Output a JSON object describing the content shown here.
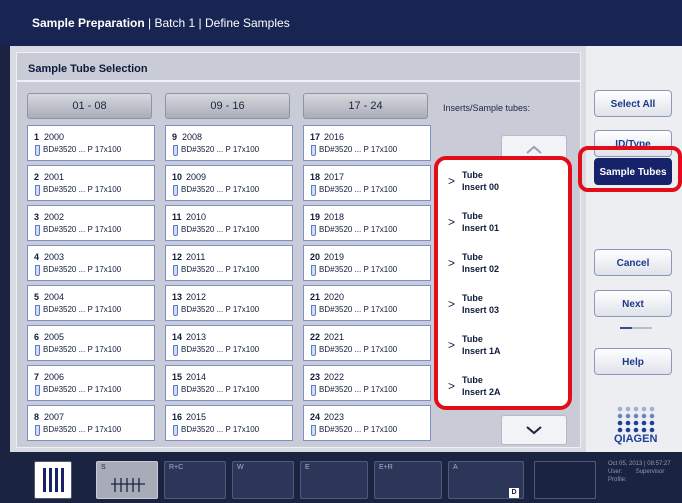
{
  "header": {
    "title_bold": "Sample Preparation",
    "title_rest": " | Batch 1 | Define Samples"
  },
  "panel": {
    "title": "Sample Tube Selection",
    "inserts_label": "Inserts/Sample tubes:"
  },
  "column_headers": [
    "01 - 08",
    "09 - 16",
    "17 - 24"
  ],
  "tube_type": "BD#3520 ... P 17x100",
  "tubes": [
    {
      "num": "1",
      "id": "2000"
    },
    {
      "num": "2",
      "id": "2001"
    },
    {
      "num": "3",
      "id": "2002"
    },
    {
      "num": "4",
      "id": "2003"
    },
    {
      "num": "5",
      "id": "2004"
    },
    {
      "num": "6",
      "id": "2005"
    },
    {
      "num": "7",
      "id": "2006"
    },
    {
      "num": "8",
      "id": "2007"
    },
    {
      "num": "9",
      "id": "2008"
    },
    {
      "num": "10",
      "id": "2009"
    },
    {
      "num": "11",
      "id": "2010"
    },
    {
      "num": "12",
      "id": "2011"
    },
    {
      "num": "13",
      "id": "2012"
    },
    {
      "num": "14",
      "id": "2013"
    },
    {
      "num": "15",
      "id": "2014"
    },
    {
      "num": "16",
      "id": "2015"
    },
    {
      "num": "17",
      "id": "2016"
    },
    {
      "num": "18",
      "id": "2017"
    },
    {
      "num": "19",
      "id": "2018"
    },
    {
      "num": "20",
      "id": "2019"
    },
    {
      "num": "21",
      "id": "2020"
    },
    {
      "num": "22",
      "id": "2021"
    },
    {
      "num": "23",
      "id": "2022"
    },
    {
      "num": "24",
      "id": "2023"
    }
  ],
  "inserts": [
    {
      "line1": "Tube",
      "line2": "Insert 00"
    },
    {
      "line1": "Tube",
      "line2": "Insert 01"
    },
    {
      "line1": "Tube",
      "line2": "Insert 02"
    },
    {
      "line1": "Tube",
      "line2": "Insert 03"
    },
    {
      "line1": "Tube",
      "line2": "Insert 1A"
    },
    {
      "line1": "Tube",
      "line2": "Insert 2A"
    }
  ],
  "right_buttons": {
    "select_all": "Select All",
    "id_type": "ID/Type",
    "sample_tubes": "Sample Tubes",
    "cancel": "Cancel",
    "next": "Next",
    "help": "Help"
  },
  "logo_text": "QIAGEN",
  "bottom_slots": [
    "S",
    "R+C",
    "W",
    "E",
    "E+R",
    "A"
  ],
  "bottom_badge": "D",
  "status": {
    "datetime": "Oct 05, 2013 | 08:57:27",
    "user_label": "User:",
    "user_value": "Supervisor",
    "profile_label": "Profile:"
  },
  "colors": {
    "header": "#182552",
    "highlight": "#e20d18",
    "accent": "#1a3a8a",
    "qiagen_blue": "#1b3f9a"
  }
}
